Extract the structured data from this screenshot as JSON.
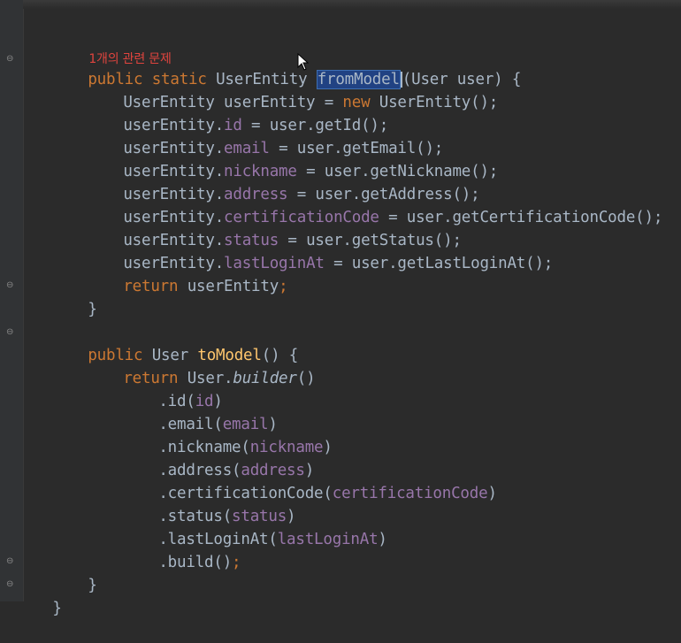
{
  "hint": "1개의 관련 문제",
  "from_model": {
    "signature": {
      "kw1": "public",
      "kw2": "static",
      "type": "UserEntity",
      "name": "fromModel",
      "params": "(User user) {"
    },
    "line_decl": {
      "a": "UserEntity userEntity = ",
      "kw": "new",
      "b": " UserEntity();"
    },
    "assignments": [
      {
        "obj": "userEntity.",
        "field": "id",
        "rhs": " = user.getId();"
      },
      {
        "obj": "userEntity.",
        "field": "email",
        "rhs": " = user.getEmail();"
      },
      {
        "obj": "userEntity.",
        "field": "nickname",
        "rhs": " = user.getNickname();"
      },
      {
        "obj": "userEntity.",
        "field": "address",
        "rhs": " = user.getAddress();"
      },
      {
        "obj": "userEntity.",
        "field": "certificationCode",
        "rhs": " = user.getCertificationCode();"
      },
      {
        "obj": "userEntity.",
        "field": "status",
        "rhs": " = user.getStatus();"
      },
      {
        "obj": "userEntity.",
        "field": "lastLoginAt",
        "rhs": " = user.getLastLoginAt();"
      }
    ],
    "return_kw": "return",
    "return_val": " userEntity",
    "semicolon": ";",
    "close": "}"
  },
  "to_model": {
    "signature": {
      "kw1": "public",
      "type": " User ",
      "name": "toModel",
      "params": "() {"
    },
    "return_kw": "return",
    "return_obj": " User.",
    "builder": "builder",
    "builder_paren": "()",
    "chain": [
      {
        "call": ".id(",
        "arg": "id",
        "end": ")"
      },
      {
        "call": ".email(",
        "arg": "email",
        "end": ")"
      },
      {
        "call": ".nickname(",
        "arg": "nickname",
        "end": ")"
      },
      {
        "call": ".address(",
        "arg": "address",
        "end": ")"
      },
      {
        "call": ".certificationCode(",
        "arg": "certificationCode",
        "end": ")"
      },
      {
        "call": ".status(",
        "arg": "status",
        "end": ")"
      },
      {
        "call": ".lastLoginAt(",
        "arg": "lastLoginAt",
        "end": ")"
      }
    ],
    "build": ".build()",
    "semicolon": ";",
    "close": "}"
  },
  "class_close": "}",
  "colors": {
    "background": "#2b2b2b",
    "keyword": "#cc7832",
    "text": "#a9b7c6",
    "field": "#9876aa",
    "method": "#ffc66d",
    "hint": "#e0443e",
    "selection": "#214283"
  }
}
